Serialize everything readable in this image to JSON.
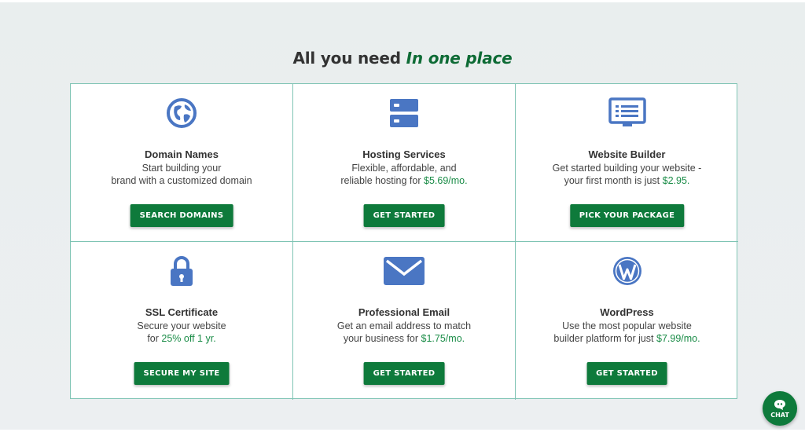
{
  "headline": {
    "prefix": "All you need",
    "accent": "In one place"
  },
  "cards": [
    {
      "title": "Domain Names",
      "line1": "Start building your",
      "line2": "brand with a customized domain",
      "price": "",
      "line2_after": "",
      "button": "SEARCH DOMAINS",
      "icon": "globe-icon"
    },
    {
      "title": "Hosting Services",
      "line1": "Flexible, affordable, and",
      "line2": "reliable hosting for",
      "price": "$5.69/mo.",
      "line2_after": "",
      "button": "GET STARTED",
      "icon": "server-icon"
    },
    {
      "title": "Website Builder",
      "line1": "Get started building your website -",
      "line2": "your first month is just",
      "price": "$2.95.",
      "line2_after": "",
      "button": "PICK YOUR PACKAGE",
      "icon": "monitor-icon"
    },
    {
      "title": "SSL Certificate",
      "line1": "Secure your website",
      "line2": "for",
      "price": "25% off 1 yr.",
      "line2_after": "",
      "button": "SECURE MY SITE",
      "icon": "lock-icon"
    },
    {
      "title": "Professional Email",
      "line1": "Get an email address to match",
      "line2": "your business for",
      "price": "$1.75/mo.",
      "line2_after": "",
      "button": "GET STARTED",
      "icon": "envelope-icon"
    },
    {
      "title": "WordPress",
      "line1": "Use the most popular website",
      "line2": "builder platform for just",
      "price": "$7.99/mo.",
      "line2_after": "",
      "button": "GET STARTED",
      "icon": "wordpress-icon"
    }
  ],
  "chat": {
    "label": "CHAT",
    "icon": "chat-bubble-icon"
  },
  "colors": {
    "accent_green": "#0e6b35",
    "button_green": "#0e7a3b",
    "price_green": "#1a8c47",
    "icon_blue": "#4a76c3",
    "border": "#7fc4b4"
  }
}
